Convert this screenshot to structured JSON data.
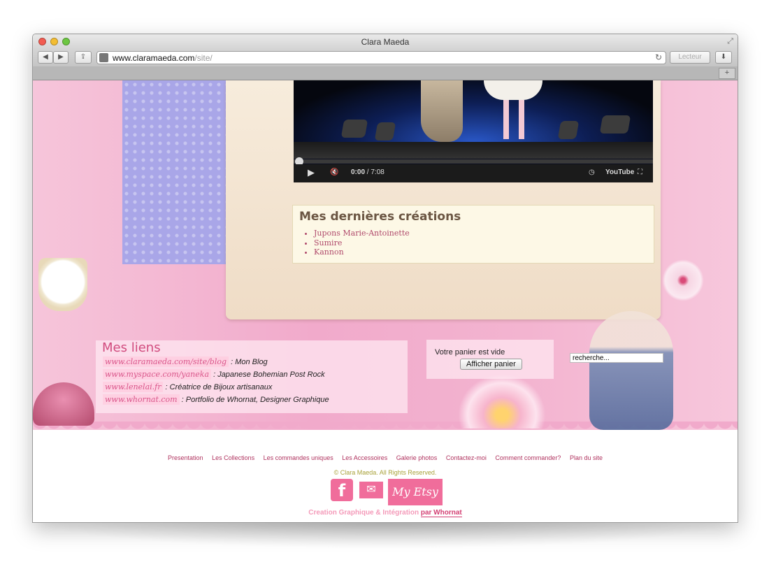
{
  "window": {
    "title": "Clara Maeda"
  },
  "toolbar": {
    "url_domain": "www.claramaeda.com",
    "url_path": "/site/",
    "reader_label": "Lecteur"
  },
  "video": {
    "time_current": "0:00",
    "time_total": "/ 7:08",
    "brand": "YouTube"
  },
  "creations": {
    "title": "Mes dernières créations",
    "items": [
      "Jupons Marie-Antoinette",
      "Sumire",
      "Kannon"
    ]
  },
  "links": {
    "title": "Mes liens",
    "rows": [
      {
        "url": "www.claramaeda.com/site/blog",
        "desc": ": Mon Blog"
      },
      {
        "url": "www.myspace.com/yaneka",
        "desc": ": Japanese Bohemian Post Rock"
      },
      {
        "url": "www.lenelai.fr",
        "desc": ": Créatrice de Bijoux artisanaux"
      },
      {
        "url": "www.whornat.com",
        "desc": ": Portfolio de Whornat, Designer Graphique"
      }
    ]
  },
  "cart": {
    "status": "Votre panier est vide",
    "button": "Afficher panier"
  },
  "search": {
    "value": "recherche..."
  },
  "footer": {
    "nav": [
      "Presentation",
      "Les Collections",
      "Les commandes uniques",
      "Les Accessoires",
      "Galerie photos",
      "Contactez-moi",
      "Comment commander?",
      "Plan du site"
    ],
    "copyright": "© Clara Maeda. All Rights Reserved.",
    "etsy": "My Etsy",
    "credit_text": "Creation Graphique & Intégration",
    "credit_by": "par Whornat"
  },
  "icons": {
    "facebook": "f",
    "mail": "✉"
  },
  "colors": {
    "accent_pink": "#f06d9b",
    "link_pink": "#d9558a",
    "title_brown": "#6b5643"
  }
}
